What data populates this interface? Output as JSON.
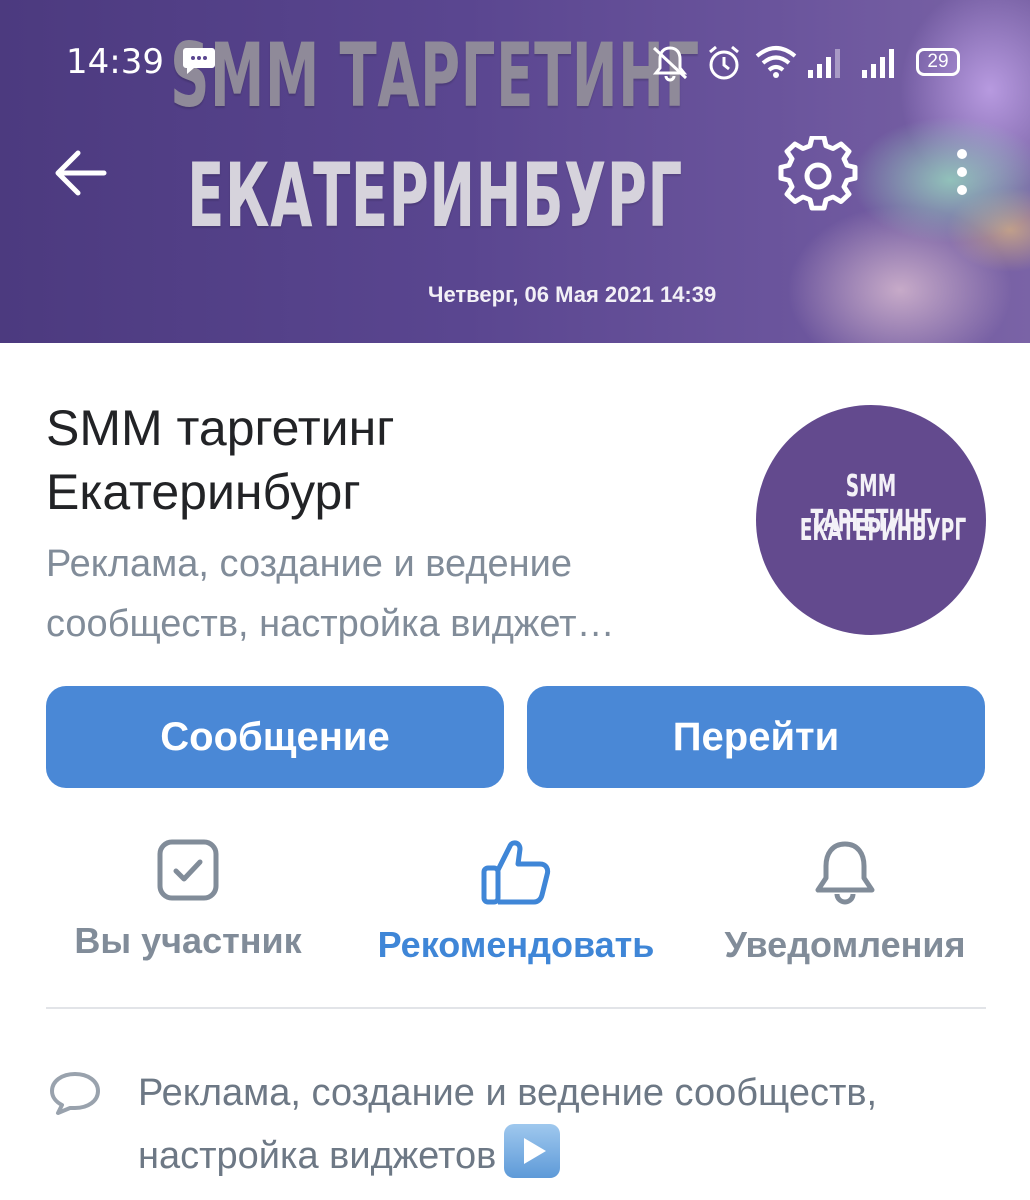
{
  "status_bar": {
    "time": "14:39",
    "battery": "29",
    "icons": [
      "message-notification-icon",
      "mute-icon",
      "alarm-icon",
      "wifi-icon",
      "signal-icon",
      "signal-icon",
      "battery-icon"
    ]
  },
  "cover": {
    "title_line1": "SMM ТАРГЕТИНГ",
    "title_line2": "ЕКАТЕРИНБУРГ",
    "date": "Четверг, 06 Мая 2021 14:39"
  },
  "toolbar": {
    "back_icon": "arrow-left-icon",
    "settings_icon": "gear-icon",
    "more_icon": "more-vertical-icon"
  },
  "group": {
    "name": "SMM таргетинг Екатеринбург",
    "short_description": "Реклама, создание и ведение сообществ, настройка виджет…",
    "avatar_line1": "SMM ТАРГЕТИНГ",
    "avatar_line2": "ЕКАТЕРИНБУРГ"
  },
  "buttons": {
    "message": "Сообщение",
    "go": "Перейти"
  },
  "actions": {
    "member": "Вы участник",
    "recommend": "Рекомендовать",
    "notifications": "Уведомления"
  },
  "info": {
    "description": "Реклама, создание и ведение сообществ, настройка виджетов"
  },
  "colors": {
    "accent": "#4a88d6",
    "accent_text": "#3f86d7",
    "secondary_text": "#818c99",
    "cover_purple": "#5a4690",
    "avatar_purple": "#634a8e"
  }
}
